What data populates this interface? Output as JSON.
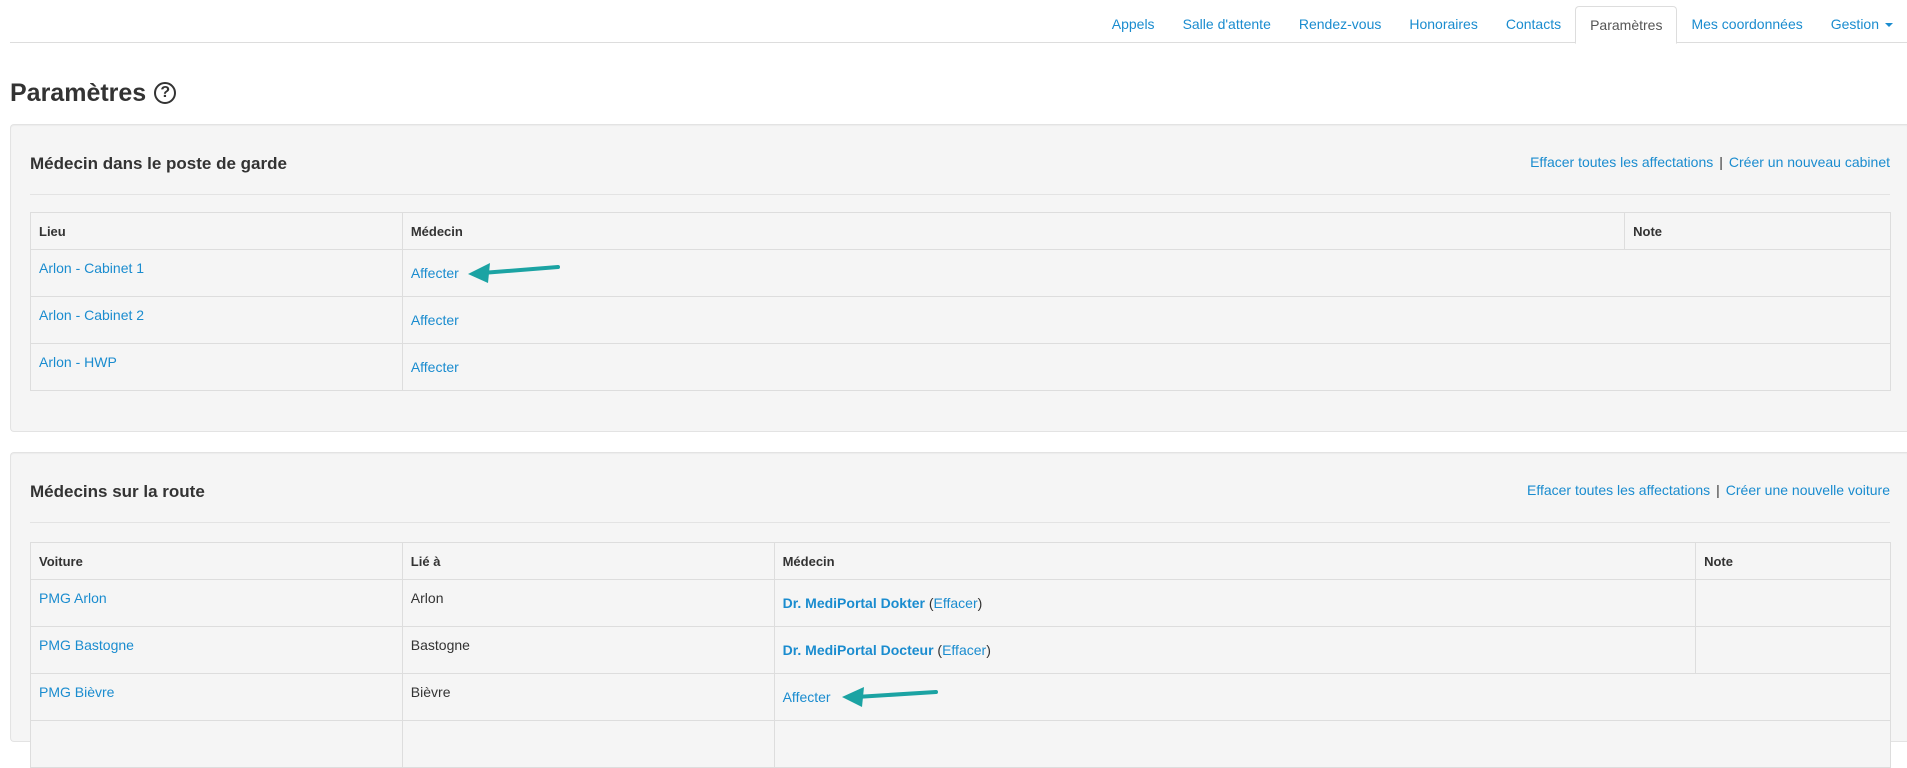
{
  "nav": {
    "tabs": [
      {
        "label": "Appels",
        "active": false
      },
      {
        "label": "Salle d'attente",
        "active": false
      },
      {
        "label": "Rendez-vous",
        "active": false
      },
      {
        "label": "Honoraires",
        "active": false
      },
      {
        "label": "Contacts",
        "active": false
      },
      {
        "label": "Paramètres",
        "active": true
      },
      {
        "label": "Mes coordonnées",
        "active": false
      },
      {
        "label": "Gestion",
        "active": false,
        "dropdown": true
      }
    ]
  },
  "page": {
    "title": "Paramètres",
    "help_icon": "question-circle-icon"
  },
  "section1": {
    "title": "Médecin dans le poste de garde",
    "action_clear": "Effacer toutes les affectations",
    "separator": "|",
    "action_create": "Créer un nouveau cabinet",
    "columns": [
      "Lieu",
      "Médecin",
      "Note"
    ],
    "rows": [
      {
        "lieu": "Arlon - Cabinet 1",
        "medecin": "Affecter",
        "note": ""
      },
      {
        "lieu": "Arlon - Cabinet 2",
        "medecin": "Affecter",
        "note": ""
      },
      {
        "lieu": "Arlon - HWP",
        "medecin": "Affecter",
        "note": ""
      }
    ]
  },
  "section2": {
    "title": "Médecins sur la route",
    "action_clear": "Effacer toutes les affectations",
    "separator": "|",
    "action_create": "Créer une nouvelle voiture",
    "columns": [
      "Voiture",
      "Lié à",
      "Médecin",
      "Note"
    ],
    "rows": [
      {
        "voiture": "PMG Arlon",
        "lie": "Arlon",
        "doctor": "Dr. MediPortal Dokter",
        "effacer": "Effacer",
        "affecter": "",
        "note": ""
      },
      {
        "voiture": "PMG Bastogne",
        "lie": "Bastogne",
        "doctor": "Dr. MediPortal Docteur",
        "effacer": "Effacer",
        "affecter": "",
        "note": ""
      },
      {
        "voiture": "PMG Bièvre",
        "lie": "Bièvre",
        "doctor": "",
        "effacer": "",
        "affecter": "Affecter",
        "note": ""
      }
    ]
  },
  "annotations": {
    "arrow_color": "#1ba3a3",
    "arrow_icon": "annotation-arrow-icon"
  },
  "colors": {
    "link": "#1a8ccf",
    "panel_bg": "#f5f5f5",
    "border": "#dddddd"
  }
}
